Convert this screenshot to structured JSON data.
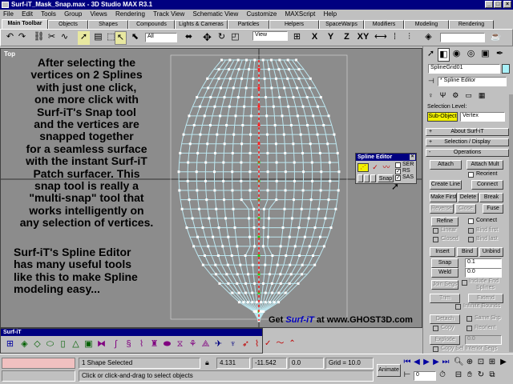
{
  "window": {
    "title": "Surf-iT_Mask_Snap.max - 3D Studio MAX R3.1",
    "minimize_label": "_",
    "maximize_label": "□",
    "close_label": "×"
  },
  "menu": [
    "File",
    "Edit",
    "Tools",
    "Group",
    "Views",
    "Rendering",
    "Track View",
    "Schematic View",
    "Customize",
    "MAXScript",
    "Help"
  ],
  "tabs": [
    "Main Toolbar",
    "Objects",
    "Shapes",
    "Compounds",
    "Lights & Cameras",
    "Particles",
    "Helpers",
    "SpaceWarps",
    "Modifiers",
    "Modeling",
    "Rendering"
  ],
  "toolbar": {
    "selection_filter": "All",
    "coord_system": "View",
    "axis_x": "X",
    "axis_y": "Y",
    "axis_z": "Z",
    "axis_xy": "XY",
    "icons": [
      "undo-icon",
      "redo-icon",
      "link-icon",
      "unlink-icon",
      "bind-spacewarp-icon",
      "select-arrow-icon",
      "select-by-name-icon",
      "move-icon",
      "rotate-icon",
      "scale-icon",
      "mirror-icon",
      "array-icon",
      "align-icon",
      "render-icon",
      "material-icon"
    ]
  },
  "viewport": {
    "label": "Top",
    "text_main": [
      "After selecting the",
      "vertices on 2 Splines",
      "with just one click,",
      "one more click with",
      "Surf-iT's Snap tool",
      "and the vertices are",
      "snapped together",
      "for a seamless surface",
      "with the instant Surf-iT",
      "Patch surfacer.  This",
      "snap tool is really a",
      "\"multi-snap\" tool that",
      "works intelligently on",
      "any selection of vertices."
    ],
    "text_second": [
      "Surf-iT's Spline Editor",
      "has many useful tools",
      "like this to make Spline",
      "modeling easy..."
    ],
    "promo_prefix": "Get",
    "promo_brand": "Surf-iT",
    "promo_suffix": "at www.GHOST3D.com"
  },
  "spline_editor_panel": {
    "title": "Spline Editor",
    "close_label": "×",
    "ser_label": "SER",
    "rs_label": "RS",
    "sas_label": "SAS",
    "snap_label": "Snap",
    "ser_checked": false,
    "rs_checked": true,
    "sas_checked": true
  },
  "command_panel": {
    "object_name": "SplineGrid01",
    "modifier_stack": "* Spline Editor",
    "selection_level_label": "Selection Level:",
    "sub_object_label": "Sub-Object",
    "sub_object_value": "Vertex",
    "rollout_about": "About Surf-iT",
    "rollout_selection": "Selection / Display",
    "rollout_operations": "Operations",
    "plus": "+",
    "minus": "-",
    "buttons": {
      "attach": "Attach",
      "attach_mult": "Attach Mult",
      "reorient": "Reorient",
      "create_line": "Create Line",
      "connect": "Connect",
      "make_first": "Make First",
      "delete": "Delete",
      "break": "Break",
      "reverse": "Reverse",
      "close": "Close",
      "fuse": "Fuse",
      "refine": "Refine",
      "connect_chk": "Connect",
      "linear": "Linear",
      "bind_first": "Bind first",
      "closed": "Closed",
      "bind_last": "Bind last",
      "insert": "Insert",
      "bind": "Bind",
      "unbind": "Unbind",
      "snap": "Snap",
      "weld": "Weld",
      "join_segs": "Join Segs",
      "include_end": "Include End",
      "splines": "Splines",
      "trim": "Trim",
      "extend": "Extend",
      "infinite_bounds": "Infinite Bounds",
      "detach": "Detach",
      "same_shp": "Same Shp",
      "copy": "Copy",
      "reorient2": "Reorient",
      "explode": "Explode",
      "copy_sel_interior": "Copy Sel Interior Segs"
    },
    "snap_value": "0.1",
    "weld_value": "0.0",
    "explode_value": "0.0"
  },
  "surfit_toolbar": {
    "title": "Surf-iT",
    "icons": [
      "surf-patch-icon",
      "cross-section-icon",
      "outline-icon",
      "cylinder-icon",
      "cone-icon",
      "pyramid-icon",
      "box-icon",
      "mirror-spline-icon",
      "snake-icon",
      "spiral-icon",
      "loft-icon",
      "vase-icon",
      "tube-icon",
      "weld-icon",
      "fan-icon",
      "wing-icon",
      "bird-icon",
      "knife-icon",
      "cursor-icon",
      "zigzag-icon",
      "wave-icon"
    ]
  },
  "status": {
    "selection": "1 Shape Selected",
    "prompt": "Click or click-and-drag to select objects",
    "x": "4.131",
    "y": "-11.542",
    "z": "0.0",
    "grid": "Grid = 10.0",
    "animate": "Animate",
    "frame": "0"
  }
}
